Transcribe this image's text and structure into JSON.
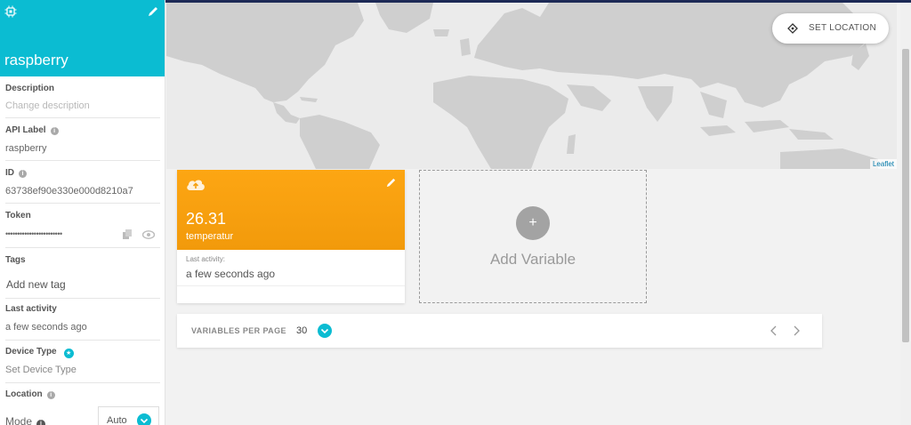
{
  "device": {
    "name": "raspberry",
    "header_color": "#0bbcd2"
  },
  "sidebar": {
    "description": {
      "label": "Description",
      "placeholder": "Change description"
    },
    "api_label": {
      "label": "API Label",
      "value": "raspberry"
    },
    "id": {
      "label": "ID",
      "value": "63738ef90e330e000d8210a7"
    },
    "token": {
      "label": "Token",
      "value": "••••••••••••••••••••••••"
    },
    "tags": {
      "label": "Tags",
      "placeholder": "Add new tag"
    },
    "last_activity": {
      "label": "Last activity",
      "value": "a few seconds ago"
    },
    "device_type": {
      "label": "Device Type",
      "placeholder": "Set Device Type"
    },
    "location": {
      "label": "Location",
      "mode_label": "Mode",
      "mode_value": "Auto"
    }
  },
  "map": {
    "attribution": "Leaflet",
    "set_location_label": "SET LOCATION"
  },
  "variable_card": {
    "value": "26.31",
    "name": "temperatur",
    "last_activity_label": "Last activity:",
    "last_activity_value": "a few seconds ago",
    "color": "#fda613"
  },
  "add_variable": {
    "label": "Add Variable"
  },
  "pagination": {
    "label": "VARIABLES PER PAGE",
    "value": "30"
  },
  "icons": {
    "chip": "chip-icon",
    "edit": "pencil-icon",
    "info": "info-icon",
    "copy": "copy-icon",
    "eye": "eye-icon",
    "star": "star-icon",
    "cloud": "cloud-upload-icon",
    "locate": "crosshair-icon",
    "chevron": "chevron-down-icon"
  }
}
